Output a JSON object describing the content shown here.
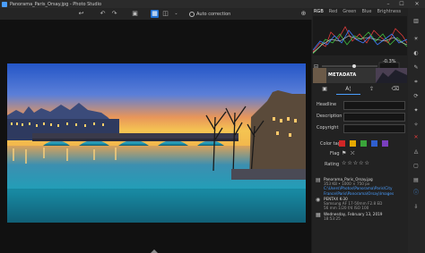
{
  "window": {
    "title": "Panorama_Paris_Orsay.jpg - Photo Studio"
  },
  "toolbar": {
    "auto_correction": "Auto correction"
  },
  "histogram": {
    "tabs": [
      "RGB",
      "Red",
      "Green",
      "Blue",
      "Brightness"
    ],
    "selected": "RGB"
  },
  "exposure": {
    "value": "-0.3%"
  },
  "metadata": {
    "title": "METADATA",
    "fields": [
      {
        "label": "Headline",
        "value": ""
      },
      {
        "label": "Description",
        "value": ""
      },
      {
        "label": "Copyright",
        "value": ""
      }
    ],
    "color_tag_label": "Color tag",
    "color_tags": [
      "#d02626",
      "#e5a800",
      "#3aa43a",
      "#2f5fcf",
      "#7a3fbf"
    ],
    "flag_label": "Flag",
    "rating_label": "Rating",
    "rating_stars": "☆☆☆☆☆"
  },
  "file_info": {
    "filename": "Panorama_Paris_Orsay.jpg",
    "size": "353 KB • 1000 × 750 px",
    "path_line1": "C:\\Users\\Photos\\Panorama\\Paris\\City",
    "path_line2": "France\\Paris\\Panorama\\Orsay\\Images",
    "camera": "PENTAX K-30",
    "lens": "Samsung AF 17-50mm F2.8 ED",
    "exposure_info": "56 mm   1/20   f/4   ISO 100",
    "date": "Wednesday, February 13, 2019",
    "time": "18:53:25"
  },
  "colors": {
    "accent": "#1f6fd1",
    "link": "#4a9eff"
  }
}
